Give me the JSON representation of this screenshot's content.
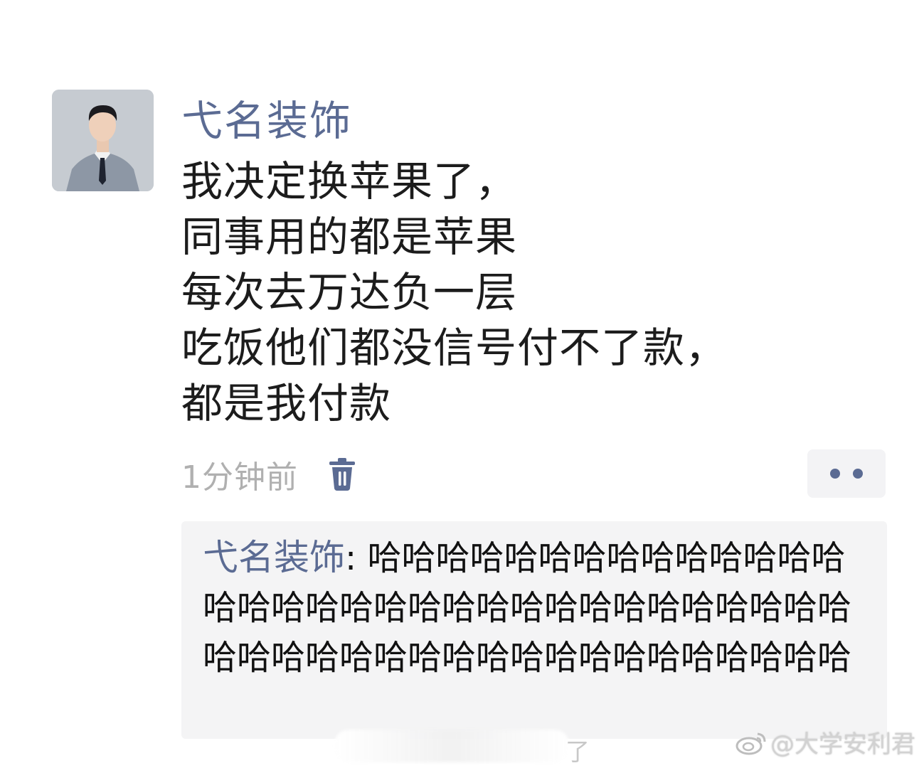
{
  "post": {
    "author": "弋名装饰",
    "message_lines": [
      "我决定换苹果了，",
      "同事用的都是苹果",
      "每次去万达负一层",
      "吃饭他们都没信号付不了款，",
      "都是我付款"
    ],
    "timestamp": "1分钟前",
    "delete_icon": "trash-icon",
    "more_icon": "more-dots-icon"
  },
  "comment": {
    "author": "弋名装饰",
    "separator": ": ",
    "text": "哈哈哈哈哈哈哈哈哈哈哈哈哈哈哈哈哈哈哈哈哈哈哈哈哈哈哈哈哈哈哈哈哈哈哈哈哈哈哈哈哈哈哈哈哈哈哈哈哈哈哈哈"
  },
  "overlay": {
    "obscured_tail": "了",
    "watermark": "@大学安利君",
    "watermark_icon": "weibo-icon"
  },
  "colors": {
    "accent": "#5b6b93",
    "timestamp": "#b0b0b0",
    "comment_bg": "#f4f4f5"
  }
}
